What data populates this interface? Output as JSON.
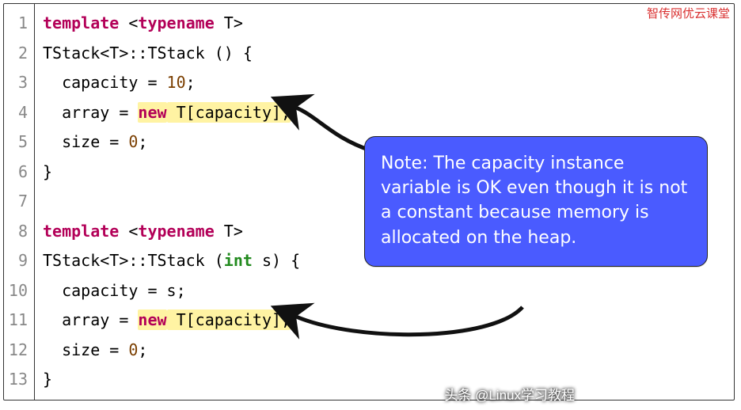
{
  "watermarks": {
    "top_right": "智传网优云课堂",
    "bottom": "头条 @Linux学习教程"
  },
  "code": {
    "lines": [
      {
        "n": "1",
        "segments": [
          {
            "t": "template",
            "cls": "kw"
          },
          {
            "t": " <",
            "cls": ""
          },
          {
            "t": "typename",
            "cls": "kw"
          },
          {
            "t": " T>",
            "cls": ""
          }
        ]
      },
      {
        "n": "2",
        "segments": [
          {
            "t": "TStack<T>::TStack () {",
            "cls": ""
          }
        ]
      },
      {
        "n": "3",
        "segments": [
          {
            "t": "  capacity = ",
            "cls": ""
          },
          {
            "t": "10",
            "cls": "num"
          },
          {
            "t": ";",
            "cls": ""
          }
        ]
      },
      {
        "n": "4",
        "segments": [
          {
            "t": "  array = ",
            "cls": ""
          },
          {
            "t": "new",
            "cls": "kw hl"
          },
          {
            "t": " T[capacity];",
            "cls": "hl"
          }
        ]
      },
      {
        "n": "5",
        "segments": [
          {
            "t": "  size = ",
            "cls": ""
          },
          {
            "t": "0",
            "cls": "num"
          },
          {
            "t": ";",
            "cls": ""
          }
        ]
      },
      {
        "n": "6",
        "segments": [
          {
            "t": "}",
            "cls": ""
          }
        ]
      },
      {
        "n": "7",
        "segments": [
          {
            "t": "",
            "cls": ""
          }
        ]
      },
      {
        "n": "8",
        "segments": [
          {
            "t": "template",
            "cls": "kw"
          },
          {
            "t": " <",
            "cls": ""
          },
          {
            "t": "typename",
            "cls": "kw"
          },
          {
            "t": " T>",
            "cls": ""
          }
        ]
      },
      {
        "n": "9",
        "segments": [
          {
            "t": "TStack<T>::TStack (",
            "cls": ""
          },
          {
            "t": "int",
            "cls": "type2"
          },
          {
            "t": " s) {",
            "cls": ""
          }
        ]
      },
      {
        "n": "10",
        "segments": [
          {
            "t": "  capacity = s;",
            "cls": ""
          }
        ]
      },
      {
        "n": "11",
        "segments": [
          {
            "t": "  array = ",
            "cls": ""
          },
          {
            "t": "new",
            "cls": "kw hl"
          },
          {
            "t": " T[capacity];",
            "cls": "hl"
          }
        ]
      },
      {
        "n": "12",
        "segments": [
          {
            "t": "  size = ",
            "cls": ""
          },
          {
            "t": "0",
            "cls": "num"
          },
          {
            "t": ";",
            "cls": ""
          }
        ]
      },
      {
        "n": "13",
        "segments": [
          {
            "t": "}",
            "cls": ""
          }
        ]
      }
    ]
  },
  "callout": {
    "text": "Note:  The capacity instance variable is OK even though it is not a constant because memory is allocated on the heap."
  }
}
